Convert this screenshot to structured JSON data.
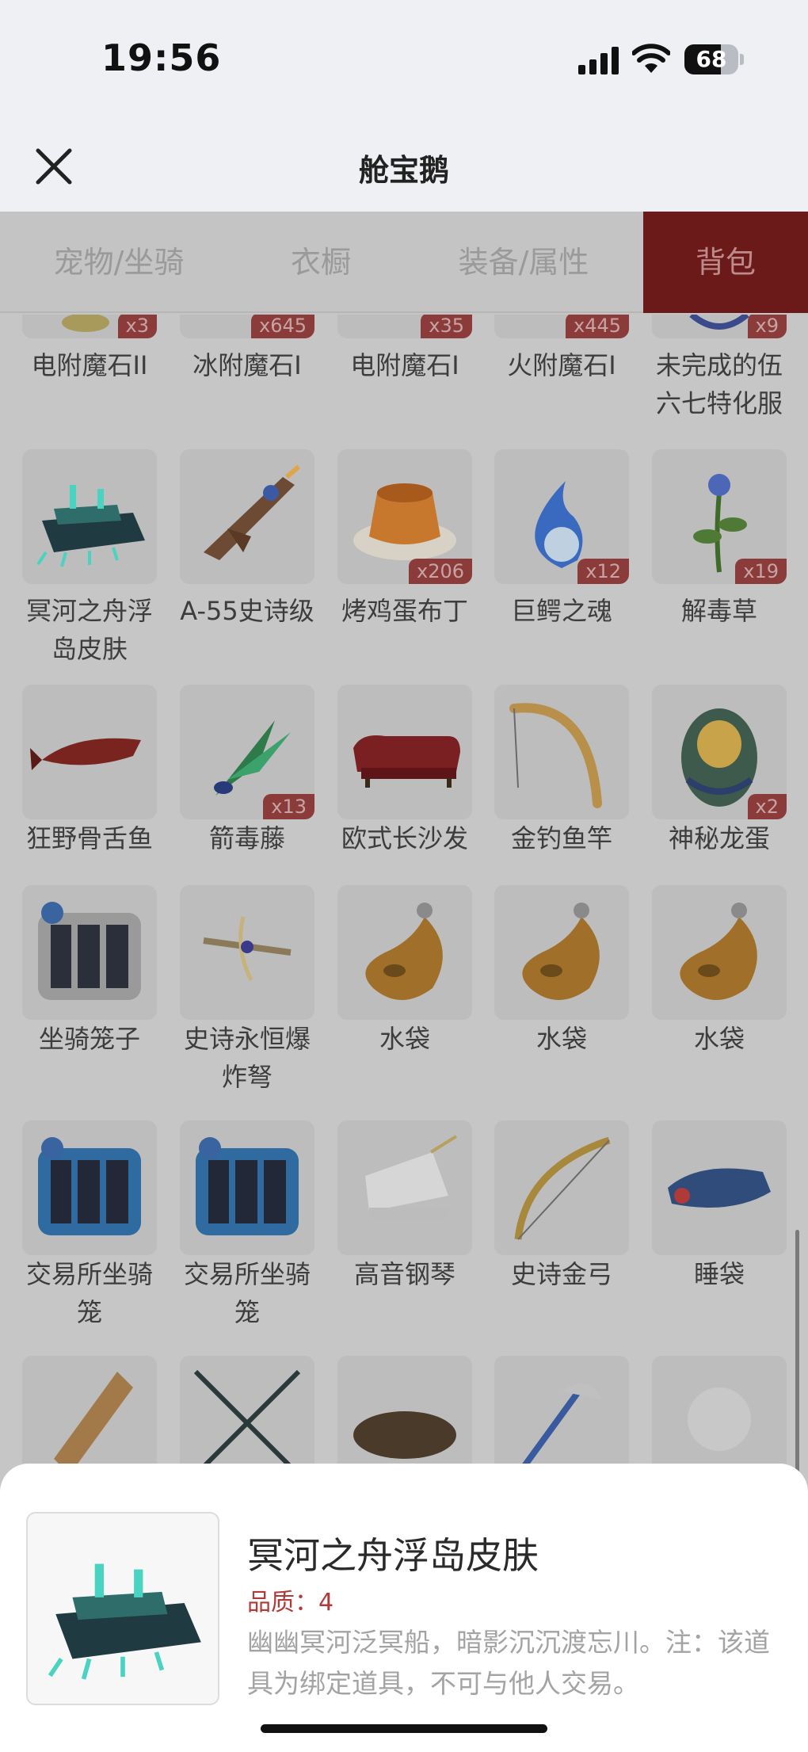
{
  "status_bar": {
    "time": "19:56",
    "battery": "68"
  },
  "header": {
    "title": "舱宝鹅"
  },
  "tabs": [
    {
      "label": "宠物/坐骑",
      "active": false
    },
    {
      "label": "衣橱",
      "active": false
    },
    {
      "label": "装备/属性",
      "active": false
    },
    {
      "label": "背包",
      "active": true
    }
  ],
  "items_row0": [
    {
      "name": "电附魔石II",
      "qty": "x3"
    },
    {
      "name": "冰附魔石I",
      "qty": "x645"
    },
    {
      "name": "电附魔石I",
      "qty": "x35"
    },
    {
      "name": "火附魔石I",
      "qty": "x445"
    },
    {
      "name": "未完成的伍六七特化服",
      "qty": "x9"
    }
  ],
  "items_row1": [
    {
      "name": "冥河之舟浮岛皮肤",
      "qty": "",
      "icon": "ship-icon"
    },
    {
      "name": "A-55史诗级",
      "qty": "",
      "icon": "gun-icon"
    },
    {
      "name": "烤鸡蛋布丁",
      "qty": "x206",
      "icon": "pudding-icon"
    },
    {
      "name": "巨鳄之魂",
      "qty": "x12",
      "icon": "soul-flame-icon"
    },
    {
      "name": "解毒草",
      "qty": "x19",
      "icon": "herb-icon"
    }
  ],
  "items_row2": [
    {
      "name": "狂野骨舌鱼",
      "qty": "",
      "icon": "fish-icon"
    },
    {
      "name": "箭毒藤",
      "qty": "x13",
      "icon": "vine-icon"
    },
    {
      "name": "欧式长沙发",
      "qty": "",
      "icon": "sofa-icon"
    },
    {
      "name": "金钓鱼竿",
      "qty": "",
      "icon": "fishing-rod-icon"
    },
    {
      "name": "神秘龙蛋",
      "qty": "x2",
      "icon": "dragon-egg-icon"
    }
  ],
  "items_row3": [
    {
      "name": "坐骑笼子",
      "qty": "",
      "icon": "cage-icon"
    },
    {
      "name": "史诗永恒爆炸弩",
      "qty": "",
      "icon": "crossbow-icon"
    },
    {
      "name": "水袋",
      "qty": "",
      "icon": "water-bag-icon"
    },
    {
      "name": "水袋",
      "qty": "",
      "icon": "water-bag-icon"
    },
    {
      "name": "水袋",
      "qty": "",
      "icon": "water-bag-icon"
    }
  ],
  "items_row4": [
    {
      "name": "交易所坐骑笼",
      "qty": "",
      "icon": "cage-blue-icon"
    },
    {
      "name": "交易所坐骑笼",
      "qty": "",
      "icon": "cage-blue-icon"
    },
    {
      "name": "高音钢琴",
      "qty": "",
      "icon": "piano-icon"
    },
    {
      "name": "史诗金弓",
      "qty": "",
      "icon": "bow-icon"
    },
    {
      "name": "睡袋",
      "qty": "",
      "icon": "sleeping-bag-icon"
    }
  ],
  "detail": {
    "name": "冥河之舟浮岛皮肤",
    "quality": "品质：4",
    "description": "幽幽冥河泛冥船，暗影沉沉渡忘川。注：该道具为绑定道具，不可与他人交易。"
  },
  "colors": {
    "accent": "#6b1a19",
    "badge": "#8a3b3a",
    "quality": "#b03a38"
  }
}
